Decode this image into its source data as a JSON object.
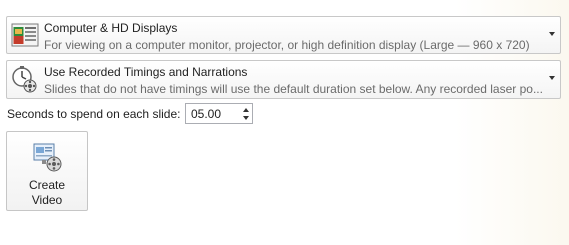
{
  "quality": {
    "title": "Computer & HD Displays",
    "description": "For viewing on a computer monitor, projector, or high definition display  (Large — 960 x 720)",
    "icon": "computer-display-icon"
  },
  "timings": {
    "title": "Use Recorded Timings and Narrations",
    "description": "Slides that do not have timings will use the default duration set below. Any recorded laser po...",
    "icon": "timings-narration-icon"
  },
  "seconds": {
    "label": "Seconds to spend on each slide:",
    "value": "05.00"
  },
  "create_button": {
    "line1": "Create",
    "line2": "Video",
    "icon": "create-video-icon"
  }
}
